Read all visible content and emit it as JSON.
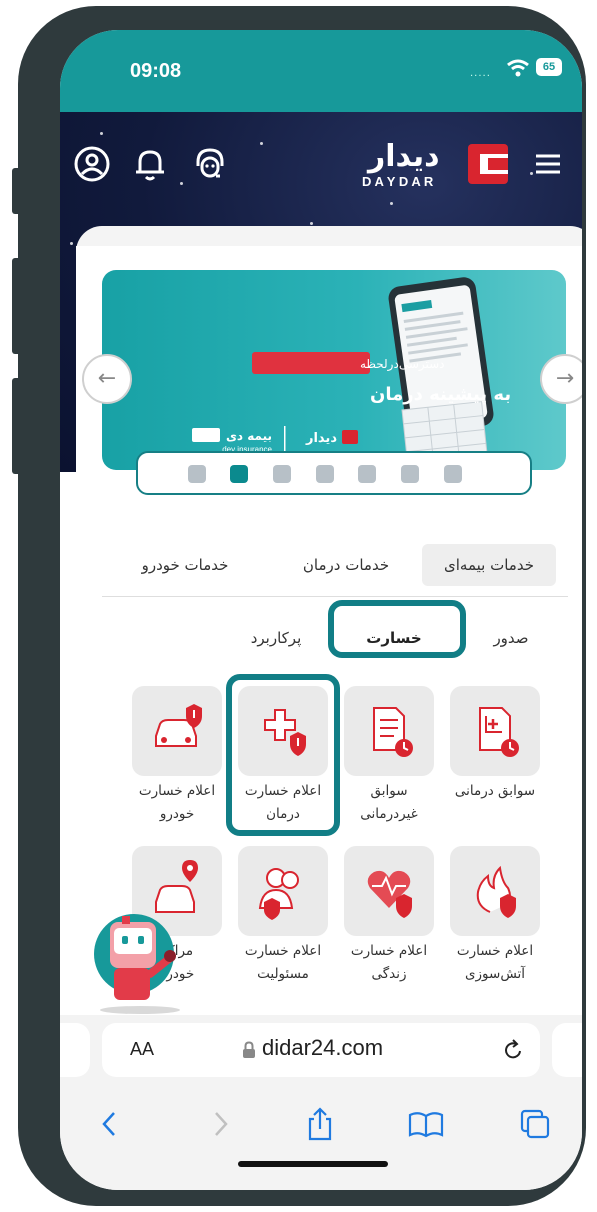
{
  "status": {
    "time": "09:08",
    "battery": "65",
    "signal": "....."
  },
  "header": {
    "logo_fa": "دیدار",
    "logo_en": "D A Y D A R"
  },
  "banner": {
    "badge": "دسترسی‌درلحظه",
    "headline": "به پیشینه درمان",
    "brand1": "بیمه دی",
    "brand1_en": "dey insurance",
    "brand2": "دیدار",
    "slide_count": 7,
    "active_slide": 2
  },
  "tabs": [
    "خدمات بیمه‌ای",
    "خدمات درمان",
    "خدمات خودرو"
  ],
  "subtabs": [
    "صدور",
    "خسارت",
    "پرکاربرد"
  ],
  "services_row1": [
    {
      "line1": "سوابق درمانی",
      "line2": "",
      "icon": "medical-record-icon"
    },
    {
      "line1": "سوابق",
      "line2": "غیردرمانی",
      "icon": "document-clock-icon"
    },
    {
      "line1": "اعلام خسارت",
      "line2": "درمان",
      "icon": "medical-cross-shield-icon"
    },
    {
      "line1": "اعلام خسارت",
      "line2": "خودرو",
      "icon": "car-shield-icon"
    }
  ],
  "services_row2": [
    {
      "line1": "اعلام خسارت",
      "line2": "آتش‌سوزی",
      "icon": "fire-shield-icon"
    },
    {
      "line1": "اعلام خسارت",
      "line2": "زندگی",
      "icon": "heart-shield-icon"
    },
    {
      "line1": "اعلام خسارت",
      "line2": "مسئولیت",
      "icon": "people-shield-icon"
    },
    {
      "line1": "مراکز",
      "line2": "خودرو",
      "icon": "car-location-icon"
    }
  ],
  "browser": {
    "aa": "AA",
    "domain": "didar24.com"
  },
  "colors": {
    "teal": "#17999a",
    "highlight": "#117e86",
    "red": "#d9252f",
    "navy": "#111a3c"
  }
}
